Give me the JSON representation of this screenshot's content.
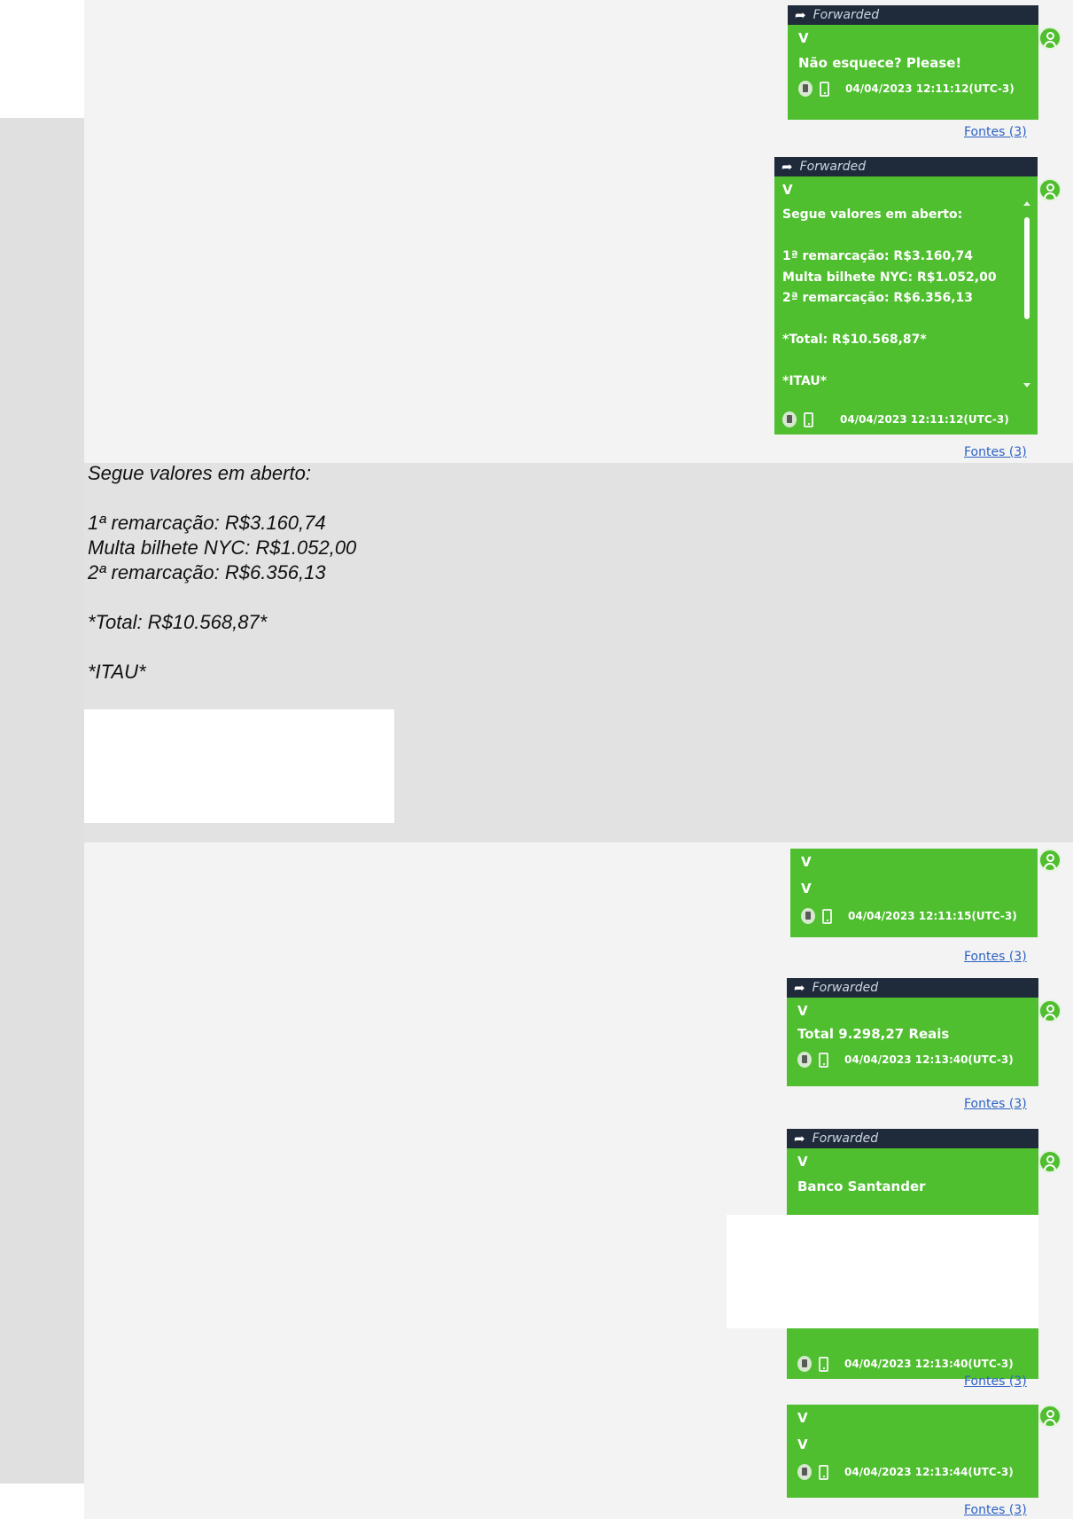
{
  "conversation_top": [
    {
      "forwarded_label": "Forwarded",
      "sender": "V",
      "text": "Não esquece? Please!",
      "timestamp": "04/04/2023 12:11:12(UTC-3)",
      "sources_link": "Fontes (3)"
    },
    {
      "forwarded_label": "Forwarded",
      "sender": "V",
      "text": "Segue valores em aberto:\n\n1ª remarcação:  R$3.160,74\nMulta bilhete NYC: R$1.052,00\n2ª remarcação: R$6.356,13\n\n*Total: R$10.568,87*\n\n*ITAU*",
      "timestamp": "04/04/2023 12:11:12(UTC-3)",
      "sources_link": "Fontes (3)"
    }
  ],
  "transcript_text": "Segue valores em aberto:\n\n1ª remarcação:  R$3.160,74\nMulta bilhete NYC: R$1.052,00\n2ª remarcação: R$6.356,13\n\n*Total: R$10.568,87*\n\n*ITAU*",
  "conversation_bottom": [
    {
      "sender": "V",
      "text": "V",
      "timestamp": "04/04/2023 12:11:15(UTC-3)",
      "sources_link": "Fontes (3)"
    },
    {
      "forwarded_label": "Forwarded",
      "sender": "V",
      "text": "Total 9.298,27 Reais",
      "timestamp": "04/04/2023 12:13:40(UTC-3)",
      "sources_link": "Fontes (3)"
    },
    {
      "forwarded_label": "Forwarded",
      "sender": "V",
      "text": "Banco Santander",
      "timestamp": "04/04/2023 12:13:40(UTC-3)",
      "sources_link": "Fontes (3)"
    },
    {
      "sender": "V",
      "text": "V",
      "timestamp": "04/04/2023 12:13:44(UTC-3)",
      "sources_link": "Fontes (3)"
    }
  ],
  "colors": {
    "bubble": "#4fbe2f",
    "forward_bar": "#1f2a3b",
    "link": "#2c62c4",
    "panel": "#f3f3f3",
    "page": "#e2e2e2"
  },
  "icons": [
    "forward-arrow-icon",
    "avatar-icon",
    "trash-icon",
    "phone-icon",
    "scroll-up-icon",
    "scroll-down-icon"
  ]
}
